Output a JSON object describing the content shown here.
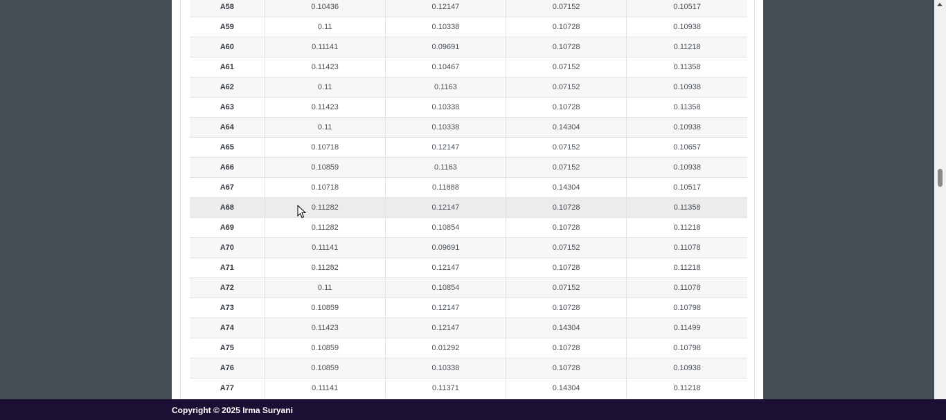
{
  "table": {
    "rows": [
      {
        "alt": "A58",
        "values": [
          "0.10436",
          "0.12147",
          "0.07152",
          "0.10517"
        ]
      },
      {
        "alt": "A59",
        "values": [
          "0.11",
          "0.10338",
          "0.10728",
          "0.10938"
        ]
      },
      {
        "alt": "A60",
        "values": [
          "0.11141",
          "0.09691",
          "0.10728",
          "0.11218"
        ]
      },
      {
        "alt": "A61",
        "values": [
          "0.11423",
          "0.10467",
          "0.07152",
          "0.11358"
        ]
      },
      {
        "alt": "A62",
        "values": [
          "0.11",
          "0.1163",
          "0.07152",
          "0.10938"
        ]
      },
      {
        "alt": "A63",
        "values": [
          "0.11423",
          "0.10338",
          "0.10728",
          "0.11358"
        ]
      },
      {
        "alt": "A64",
        "values": [
          "0.11",
          "0.10338",
          "0.14304",
          "0.10938"
        ]
      },
      {
        "alt": "A65",
        "values": [
          "0.10718",
          "0.12147",
          "0.07152",
          "0.10657"
        ]
      },
      {
        "alt": "A66",
        "values": [
          "0.10859",
          "0.1163",
          "0.07152",
          "0.10938"
        ]
      },
      {
        "alt": "A67",
        "values": [
          "0.10718",
          "0.11888",
          "0.14304",
          "0.10517"
        ]
      },
      {
        "alt": "A68",
        "values": [
          "0.11282",
          "0.12147",
          "0.10728",
          "0.11358"
        ]
      },
      {
        "alt": "A69",
        "values": [
          "0.11282",
          "0.10854",
          "0.10728",
          "0.11218"
        ]
      },
      {
        "alt": "A70",
        "values": [
          "0.11141",
          "0.09691",
          "0.07152",
          "0.11078"
        ]
      },
      {
        "alt": "A71",
        "values": [
          "0.11282",
          "0.12147",
          "0.10728",
          "0.11218"
        ]
      },
      {
        "alt": "A72",
        "values": [
          "0.11",
          "0.10854",
          "0.07152",
          "0.11078"
        ]
      },
      {
        "alt": "A73",
        "values": [
          "0.10859",
          "0.12147",
          "0.10728",
          "0.10798"
        ]
      },
      {
        "alt": "A74",
        "values": [
          "0.11423",
          "0.12147",
          "0.14304",
          "0.11499"
        ]
      },
      {
        "alt": "A75",
        "values": [
          "0.10859",
          "0.01292",
          "0.10728",
          "0.10798"
        ]
      },
      {
        "alt": "A76",
        "values": [
          "0.10859",
          "0.10338",
          "0.10728",
          "0.10938"
        ]
      },
      {
        "alt": "A77",
        "values": [
          "0.11141",
          "0.11371",
          "0.14304",
          "0.11218"
        ]
      }
    ],
    "hovered_row": "A68"
  },
  "footer": {
    "copyright": "Copyright © 2025 Irma Suryani"
  },
  "icons": {
    "cursor": "mouse-pointer-icon"
  },
  "colors": {
    "page_background": "#454d55",
    "footer_background": "#1b0f33",
    "row_stripe": "#f7f7f7",
    "row_hover": "#ececec"
  }
}
